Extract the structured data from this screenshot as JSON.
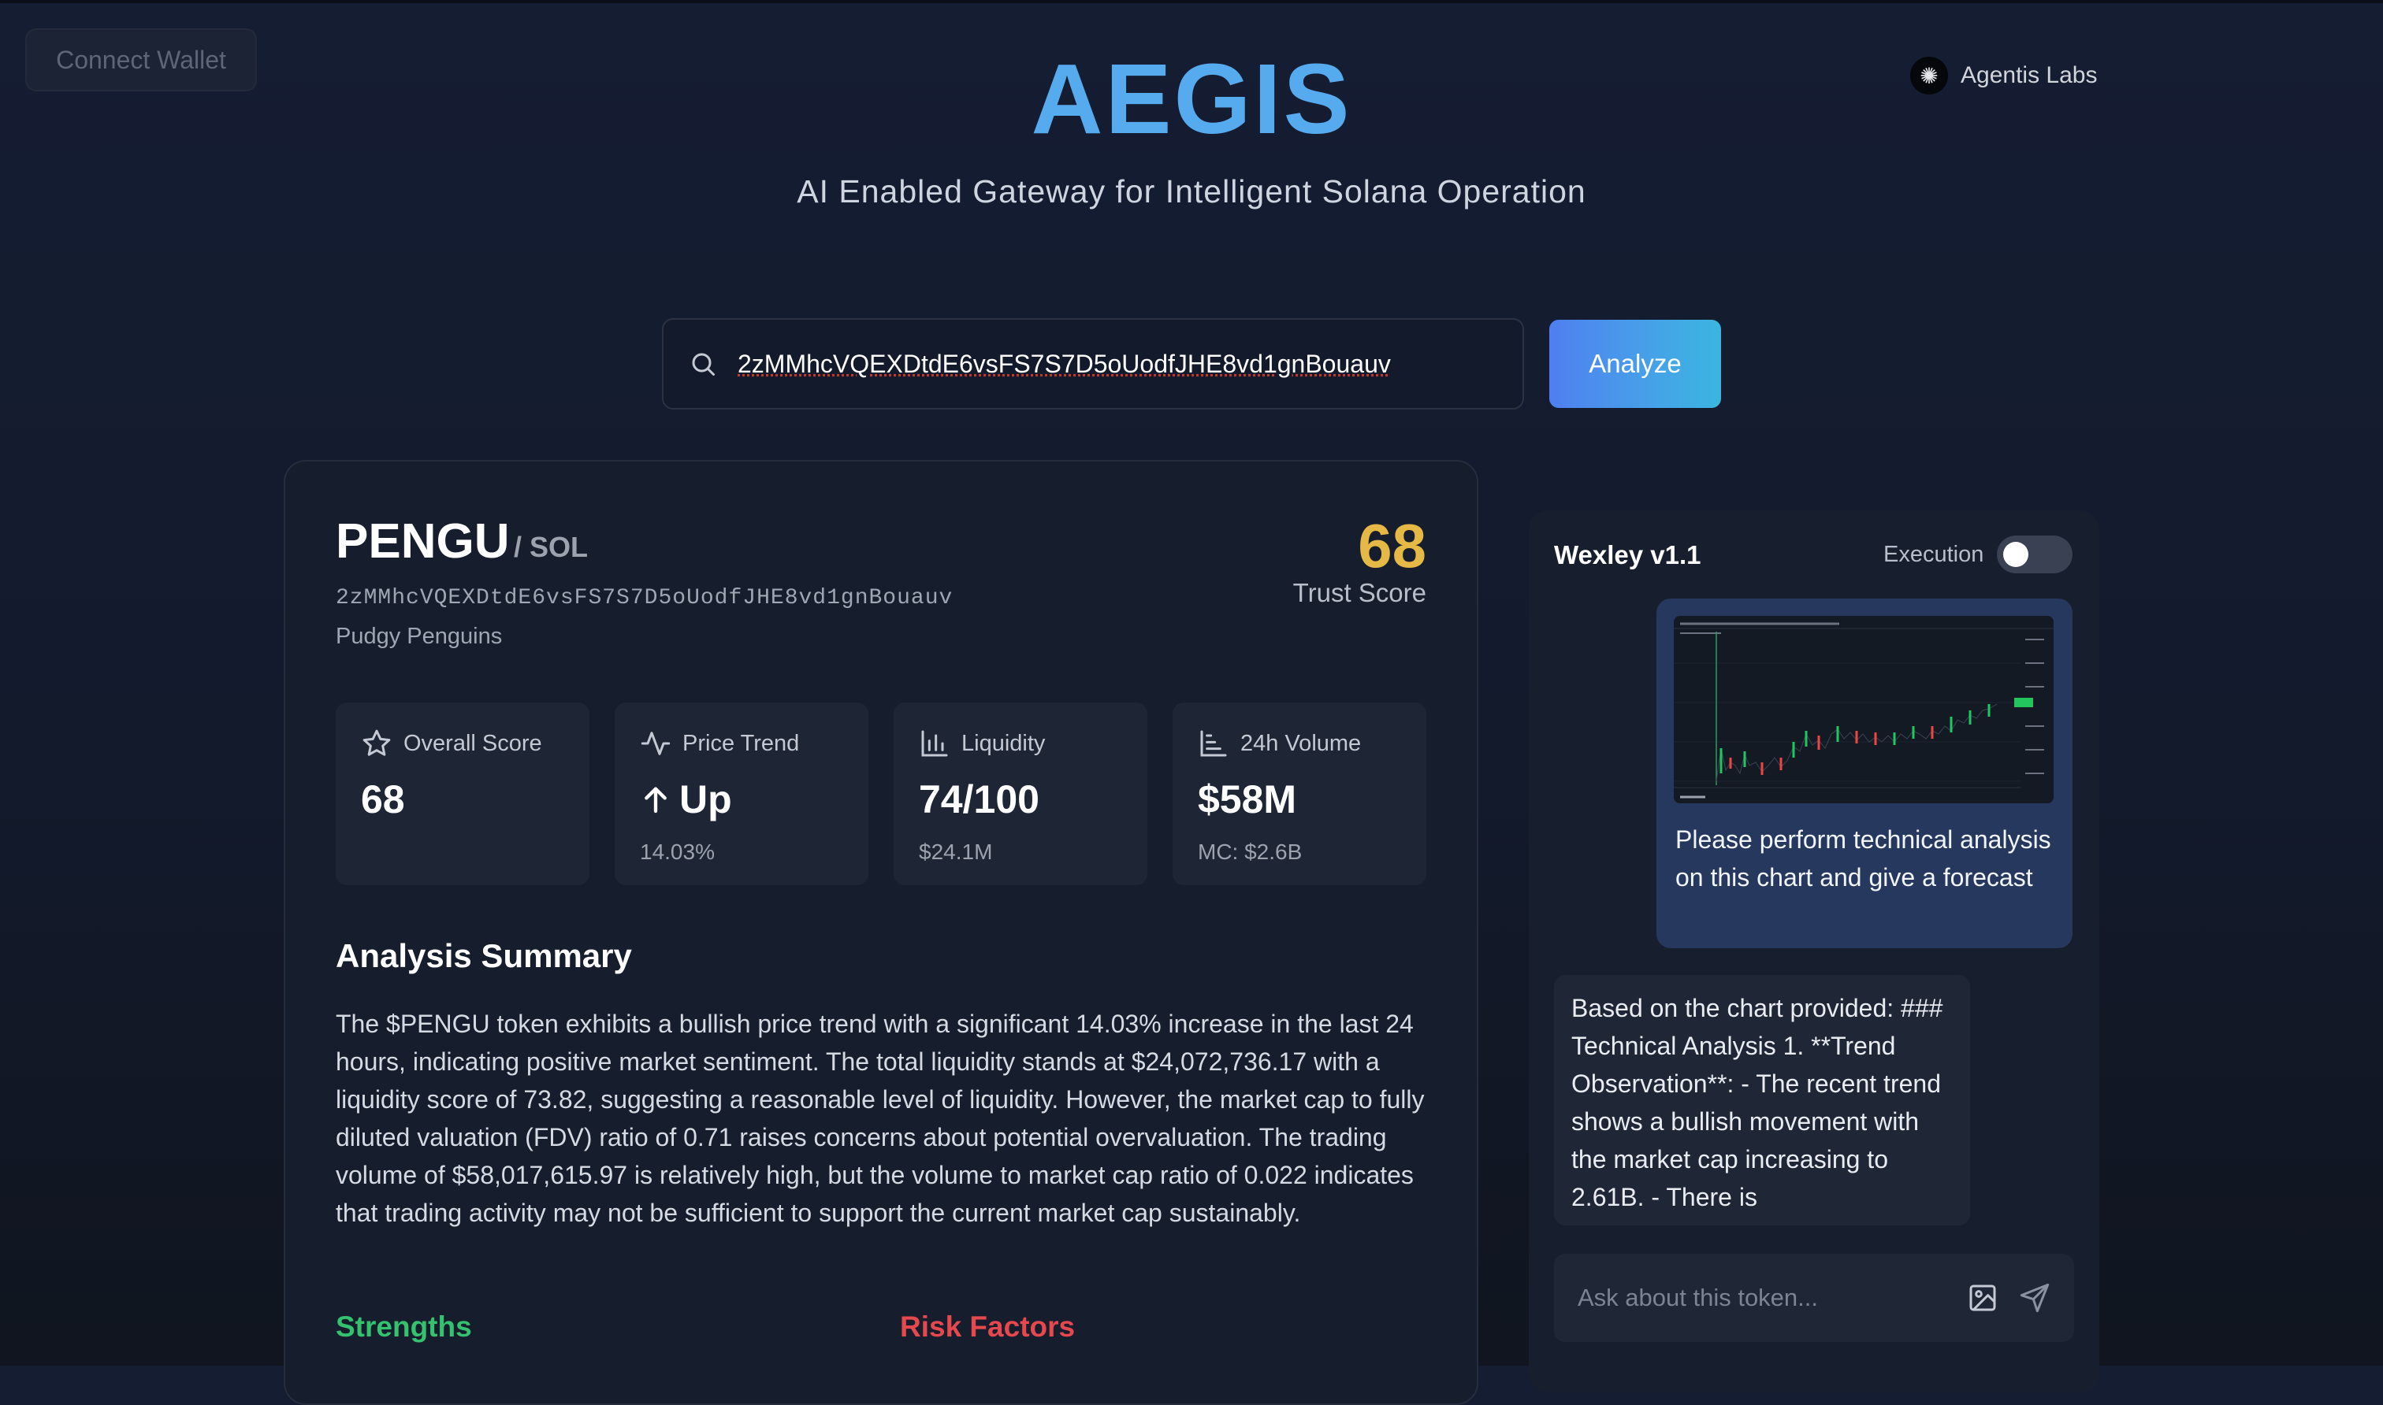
{
  "header": {
    "connect_wallet": "Connect Wallet",
    "title": "AEGIS",
    "subtitle": "AI Enabled Gateway for Intelligent Solana Operation",
    "org": "Agentis Labs"
  },
  "search": {
    "value": "2zMMhcVQEXDtdE6vsFS7S7D5oUodfJHE8vd1gnBouauv",
    "button": "Analyze"
  },
  "token": {
    "symbol": "PENGU",
    "chain": "/ SOL",
    "address": "2zMMhcVQEXDtdE6vsFS7S7D5oUodfJHE8vd1gnBouauv",
    "full_name": "Pudgy Penguins",
    "trust_score": "68",
    "trust_label": "Trust Score"
  },
  "stats": [
    {
      "label": "Overall Score",
      "value": "68",
      "sub": "",
      "icon": "star-icon"
    },
    {
      "label": "Price Trend",
      "value": "Up",
      "sub": "14.03%",
      "icon": "activity-icon"
    },
    {
      "label": "Liquidity",
      "value": "74/100",
      "sub": "$24.1M",
      "icon": "bar-chart-icon"
    },
    {
      "label": "24h Volume",
      "value": "$58M",
      "sub": "MC: $2.6B",
      "icon": "bar-chart-horizontal-icon"
    }
  ],
  "summary": {
    "title": "Analysis Summary",
    "text": "The $PENGU token exhibits a bullish price trend with a significant 14.03% increase in the last 24 hours, indicating positive market sentiment. The total liquidity stands at $24,072,736.17 with a liquidity score of 73.82, suggesting a reasonable level of liquidity. However, the market cap to fully diluted valuation (FDV) ratio of 0.71 raises concerns about potential overvaluation. The trading volume of $58,017,615.97 is relatively high, but the volume to market cap ratio of 0.022 indicates that trading activity may not be sufficient to support the current market cap sustainably."
  },
  "sections": {
    "strengths": "Strengths",
    "risks": "Risk Factors"
  },
  "chat": {
    "title": "Wexley v1.1",
    "execution_label": "Execution",
    "execution_on": false,
    "user_message": "Please perform technical analysis on this chart and give a forecast",
    "bot_message": "Based on the chart provided: ### Technical Analysis 1. **Trend Observation**: - The recent trend shows a bullish movement with the market cap increasing to 2.61B. - There is",
    "input_placeholder": "Ask about this token..."
  },
  "colors": {
    "brand": "#56aaee",
    "trust_score": "#e6b845",
    "strengths": "#34c26f",
    "risks": "#e5484d"
  }
}
